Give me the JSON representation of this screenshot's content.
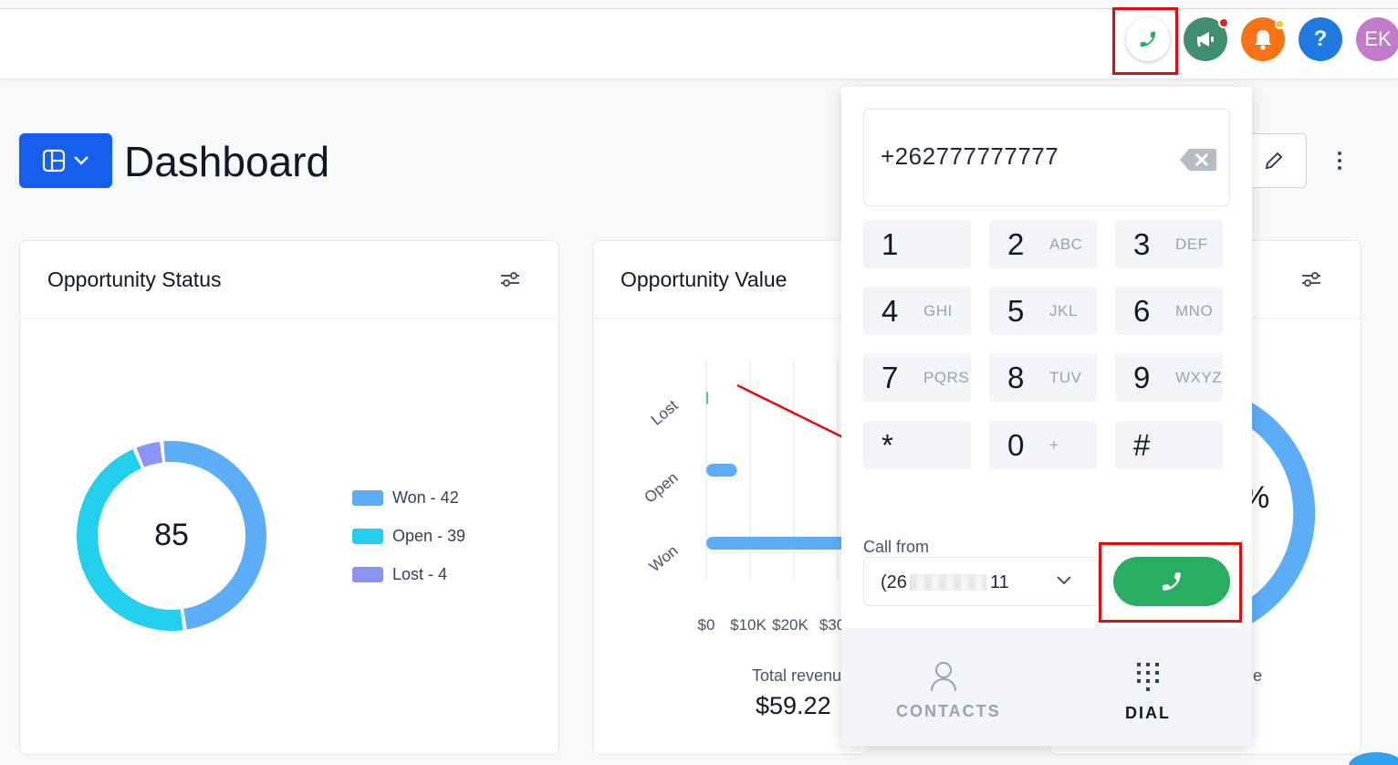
{
  "topbar": {
    "icons": {
      "phone": "phone-icon",
      "announce": "megaphone-icon",
      "bell": "bell-icon",
      "help": "?",
      "avatar": "EK"
    },
    "colors": {
      "phone_green": "#27ae60",
      "announce_bg": "#3f8f70",
      "bell_bg": "#f97316",
      "help_bg": "#1f7ae0",
      "avatar_bg": "#c17bc9",
      "annotation_red": "#e10c0c"
    }
  },
  "header": {
    "title": "Dashboard"
  },
  "cards": {
    "status": {
      "title": "Opportunity Status",
      "center_value": "85",
      "legend": [
        {
          "label": "Won - 42",
          "color": "#5cadf8"
        },
        {
          "label": "Open - 39",
          "color": "#22d0ee"
        },
        {
          "label": "Lost - 4",
          "color": "#8b93f6"
        }
      ]
    },
    "value": {
      "title": "Opportunity Value",
      "total_label": "Total revenu",
      "total_value": "$59.22"
    },
    "third": {
      "partial_percent": "%",
      "partial_label": "e"
    }
  },
  "chart_data": {
    "type": "bar",
    "orientation": "horizontal",
    "categories": [
      "Lost",
      "Open",
      "Won"
    ],
    "x_ticks": [
      "$0",
      "$10K",
      "$20K",
      "$30"
    ],
    "values": [
      150,
      7000,
      59220
    ],
    "grid": true
  },
  "donut_data": {
    "type": "pie",
    "categories": [
      "Won",
      "Open",
      "Lost"
    ],
    "values": [
      42,
      39,
      4
    ],
    "colors": [
      "#5cadf8",
      "#22d0ee",
      "#8b93f6"
    ]
  },
  "dialer": {
    "number": "+262777777777",
    "keys": [
      {
        "digit": "1",
        "letters": ""
      },
      {
        "digit": "2",
        "letters": "ABC"
      },
      {
        "digit": "3",
        "letters": "DEF"
      },
      {
        "digit": "4",
        "letters": "GHI"
      },
      {
        "digit": "5",
        "letters": "JKL"
      },
      {
        "digit": "6",
        "letters": "MNO"
      },
      {
        "digit": "7",
        "letters": "PQRS"
      },
      {
        "digit": "8",
        "letters": "TUV"
      },
      {
        "digit": "9",
        "letters": "WXYZ"
      },
      {
        "digit": "*",
        "letters": ""
      },
      {
        "digit": "0",
        "letters": "+"
      },
      {
        "digit": "#",
        "letters": ""
      }
    ],
    "call_from_label": "Call from",
    "call_from_prefix": "(26",
    "call_from_suffix": "11",
    "tabs": [
      {
        "label": "CONTACTS",
        "icon": "person-icon",
        "active": false
      },
      {
        "label": "DIAL",
        "icon": "dialpad-icon",
        "active": true
      }
    ]
  }
}
